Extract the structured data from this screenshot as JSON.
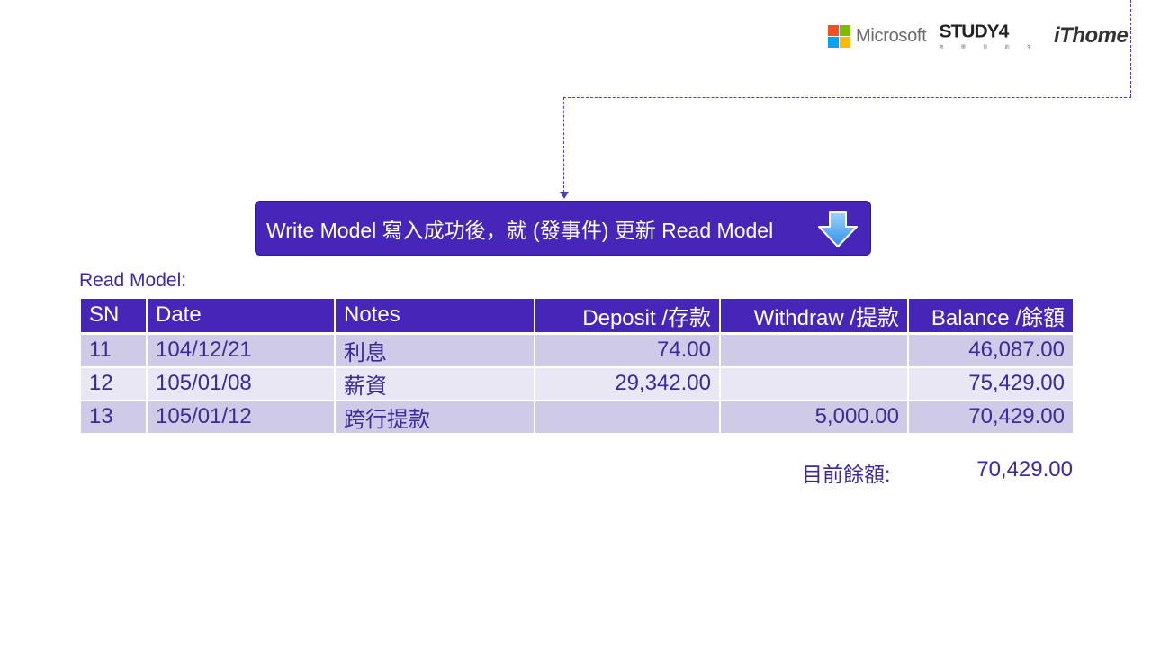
{
  "logos": {
    "microsoft": "Microsoft",
    "study4": "STUDY4",
    "study4_sub": "熱 學 習 的 生",
    "ithome": "iThome",
    "ms_colors": [
      "#f25022",
      "#7fba00",
      "#00a4ef",
      "#ffb900"
    ]
  },
  "banner": {
    "text": "Write Model 寫入成功後，就 (發事件) 更新 Read Model",
    "icon": "down-arrow-icon"
  },
  "read_model": {
    "label": "Read Model:",
    "columns": [
      "SN",
      "Date",
      "Notes",
      "Deposit /存款",
      "Withdraw /提款",
      "Balance /餘額"
    ],
    "rows": [
      {
        "sn": "11",
        "date": "104/12/21",
        "notes": "利息",
        "deposit": "74.00",
        "withdraw": "",
        "balance": "46,087.00"
      },
      {
        "sn": "12",
        "date": "105/01/08",
        "notes": "薪資",
        "deposit": "29,342.00",
        "withdraw": "",
        "balance": "75,429.00"
      },
      {
        "sn": "13",
        "date": "105/01/12",
        "notes": "跨行提款",
        "deposit": "",
        "withdraw": "5,000.00",
        "balance": "70,429.00"
      }
    ]
  },
  "current_balance": {
    "label": "目前餘額:",
    "value": "70,429.00"
  },
  "colors": {
    "primary": "#4526b8",
    "row_odd": "#cfcbe6",
    "row_even": "#e9e7f3",
    "text": "#3b2a9e"
  }
}
